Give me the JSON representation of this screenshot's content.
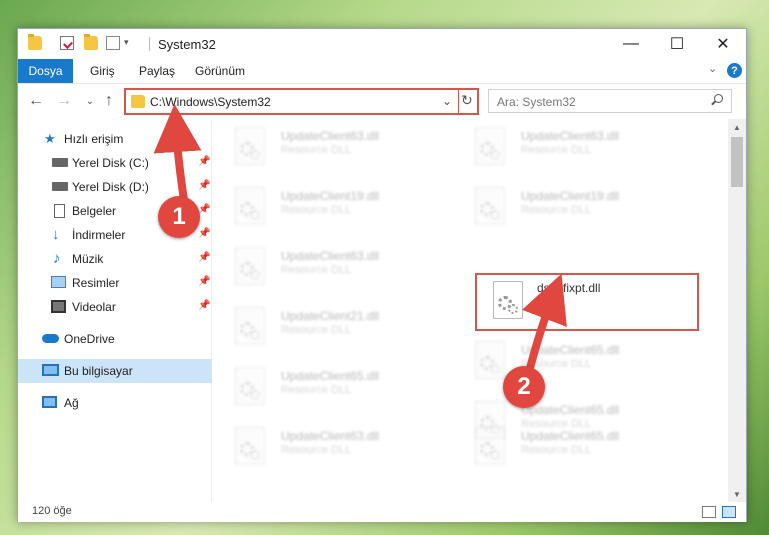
{
  "window": {
    "title": "System32",
    "controls": {
      "minimize": "—",
      "maximize": "☐",
      "close": "✕"
    }
  },
  "ribbon": {
    "file_tab": "Dosya",
    "tabs": [
      "Giriş",
      "Paylaş",
      "Görünüm"
    ],
    "help": "?"
  },
  "navigation": {
    "back": "←",
    "forward": "→",
    "recent": "⌄",
    "up": "↑",
    "address": "C:\\Windows\\System32",
    "address_dropdown": "⌄",
    "refresh": "↻",
    "search_placeholder": "Ara: System32"
  },
  "sidebar": {
    "items": [
      {
        "label": "Hızlı erişim",
        "icon": "star-icon",
        "pinned": false
      },
      {
        "label": "Yerel Disk (C:)",
        "icon": "drive-icon",
        "pinned": true
      },
      {
        "label": "Yerel Disk (D:)",
        "icon": "drive-icon",
        "pinned": true
      },
      {
        "label": "Belgeler",
        "icon": "documents-icon",
        "pinned": true
      },
      {
        "label": "İndirmeler",
        "icon": "downloads-icon",
        "pinned": true
      },
      {
        "label": "Müzik",
        "icon": "music-icon",
        "pinned": true
      },
      {
        "label": "Resimler",
        "icon": "pictures-icon",
        "pinned": true
      },
      {
        "label": "Videolar",
        "icon": "videos-icon",
        "pinned": true
      },
      {
        "label": "OneDrive",
        "icon": "cloud-icon",
        "pinned": false
      },
      {
        "label": "Bu bilgisayar",
        "icon": "computer-icon",
        "pinned": false,
        "selected": true
      },
      {
        "label": "Ağ",
        "icon": "network-icon",
        "pinned": false
      }
    ],
    "pin_glyph": "📌"
  },
  "files": [
    {
      "name": "UpdateClient63.dll",
      "desc": "Resource DLL",
      "blurred": true
    },
    {
      "name": "UpdateClient63.dll",
      "desc": "Resource DLL",
      "blurred": true
    },
    {
      "name": "UpdateClient19.dll",
      "desc": "Resource DLL",
      "blurred": true
    },
    {
      "name": "UpdateClient19.dll",
      "desc": "Resource DLL",
      "blurred": true
    },
    {
      "name": "UpdateClient63.dll",
      "desc": "Resource DLL",
      "blurred": true
    },
    {
      "name": "dsp_fixpt.dll",
      "desc": "",
      "blurred": false,
      "highlighted": true
    },
    {
      "name": "UpdateClient21.dll",
      "desc": "Resource DLL",
      "blurred": true
    },
    {
      "name": "UpdateClient65.dll",
      "desc": "Resource DLL",
      "blurred": true
    },
    {
      "name": "UpdateClient65.dll",
      "desc": "Resource DLL",
      "blurred": true
    },
    {
      "name": "UpdateClient65.dll",
      "desc": "Resource DLL",
      "blurred": true
    },
    {
      "name": "UpdateClient63.dll",
      "desc": "Resource DLL",
      "blurred": true
    },
    {
      "name": "UpdateClient65.dll",
      "desc": "Resource DLL",
      "blurred": true
    }
  ],
  "status": {
    "item_count": "120 öğe"
  },
  "annotations": {
    "badge_1": "1",
    "badge_2": "2",
    "color": "#e0473e"
  }
}
